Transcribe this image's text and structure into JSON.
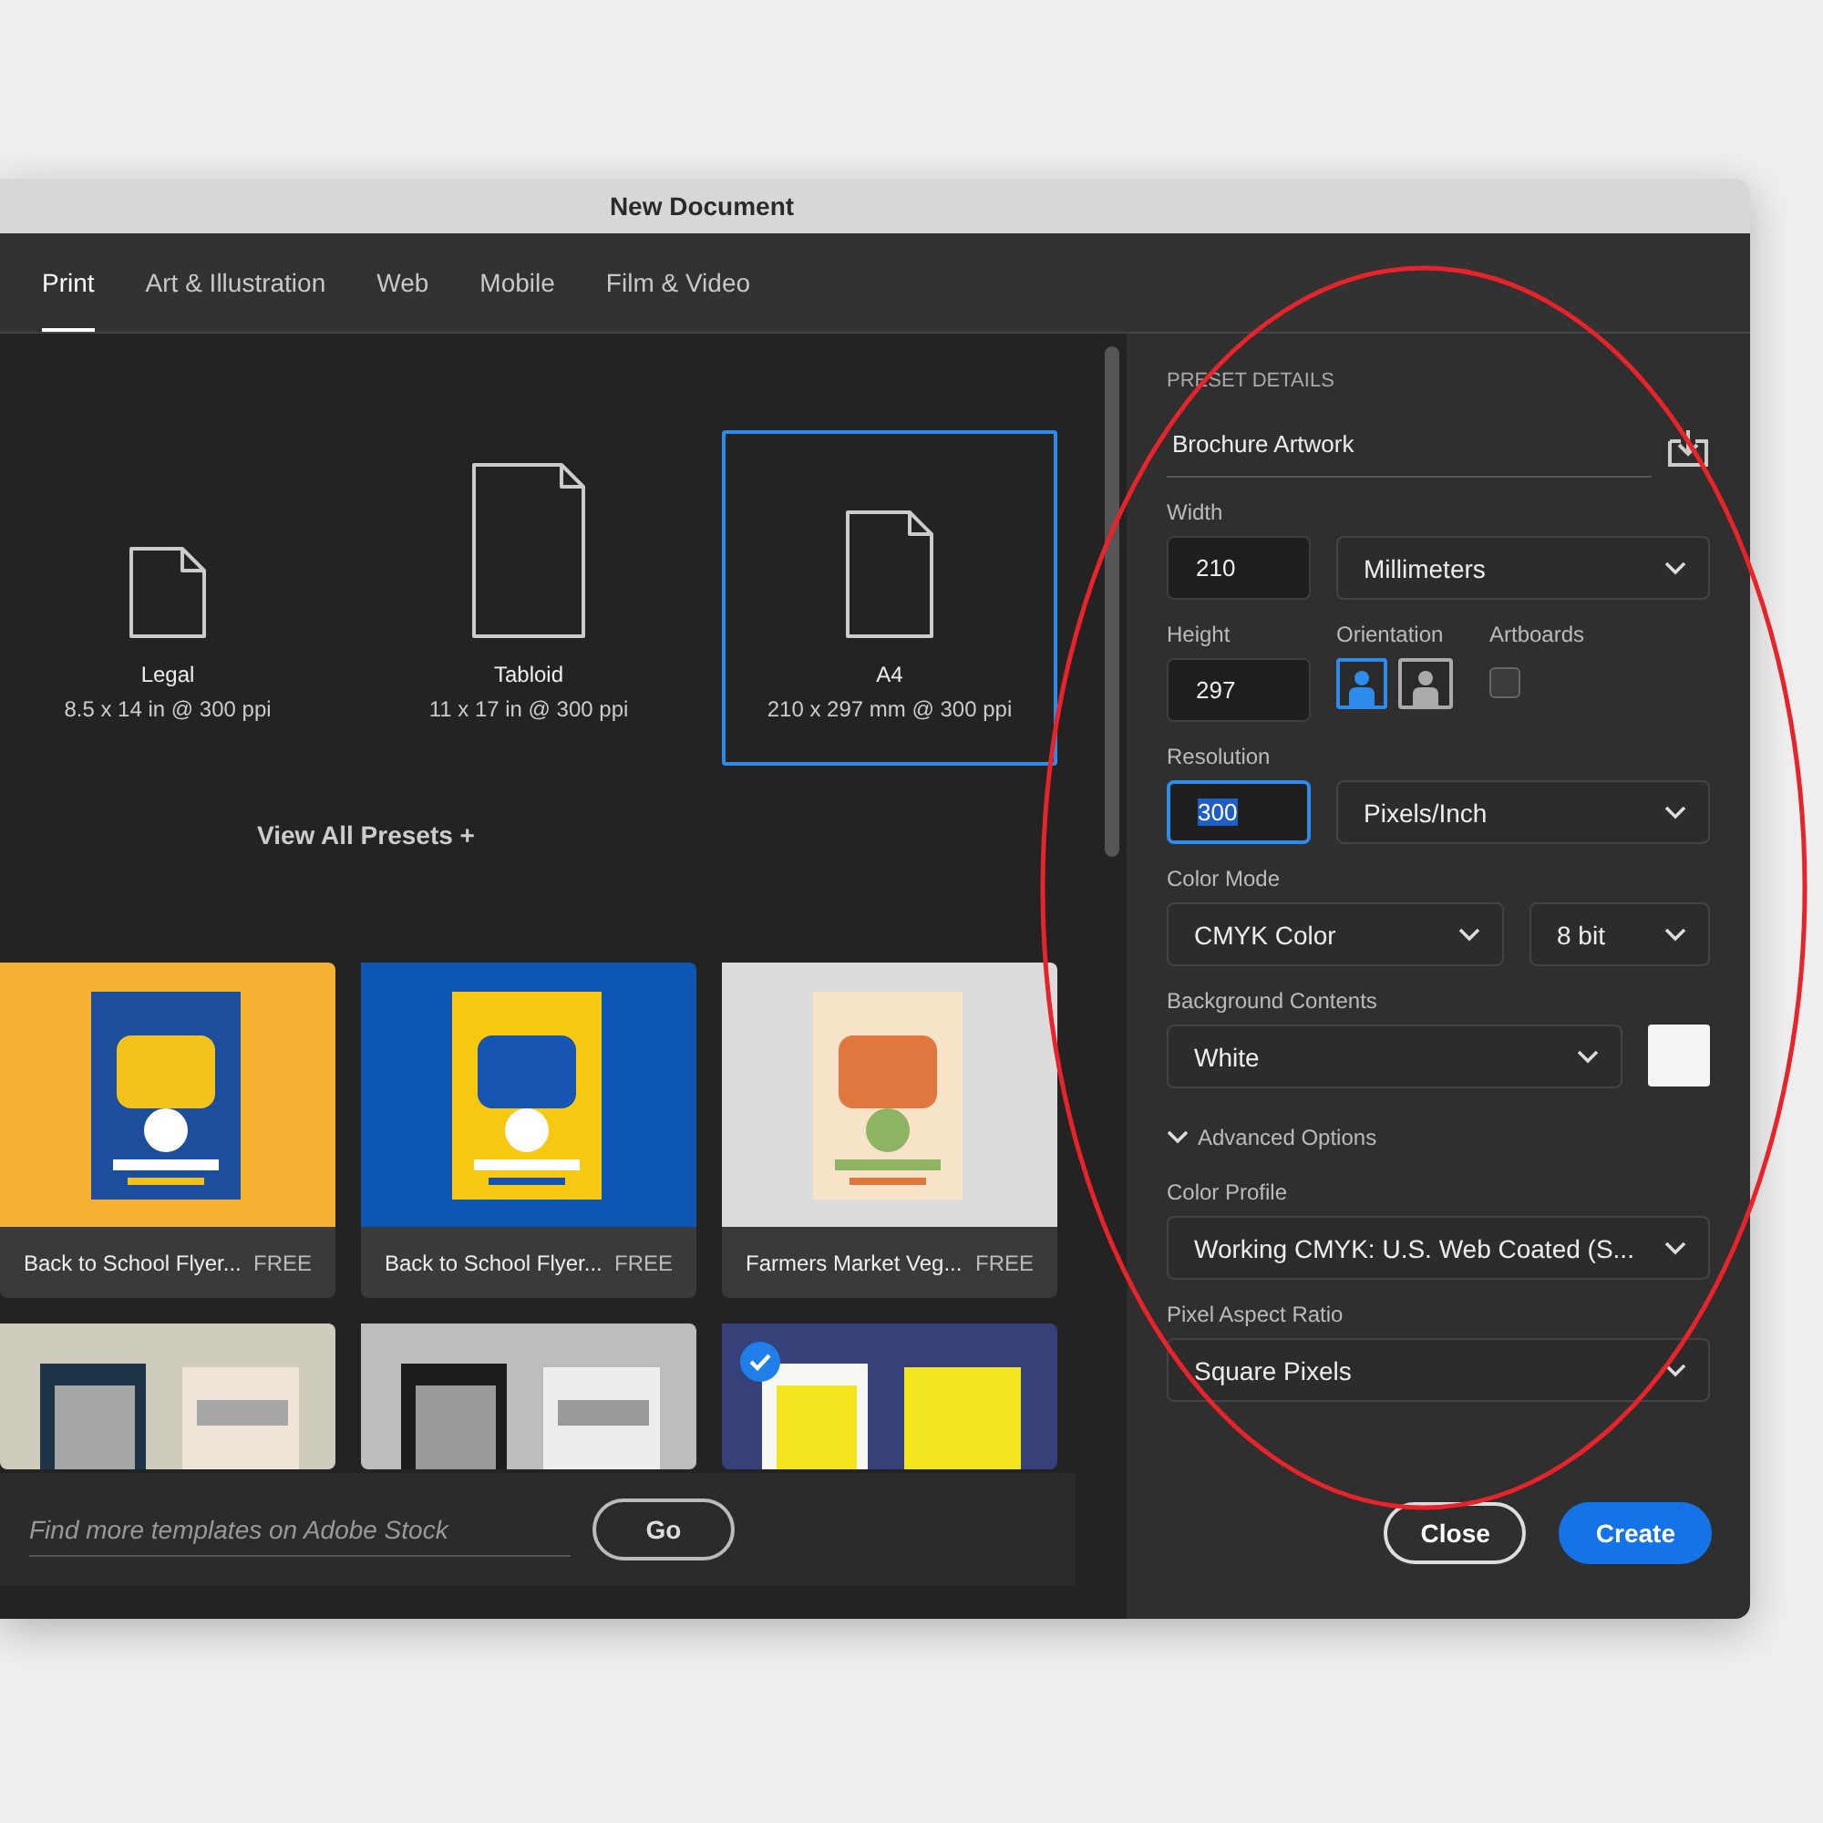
{
  "window": {
    "title": "New Document"
  },
  "tabs": [
    {
      "label": "Print",
      "selected": true
    },
    {
      "label": "Art & Illustration",
      "selected": false
    },
    {
      "label": "Web",
      "selected": false
    },
    {
      "label": "Mobile",
      "selected": false
    },
    {
      "label": "Film & Video",
      "selected": false
    }
  ],
  "presets": [
    {
      "name": "Legal",
      "size": "8.5 x 14 in @ 300 ppi",
      "kind": "small",
      "selected": false
    },
    {
      "name": "Tabloid",
      "size": "11 x 17 in @ 300 ppi",
      "kind": "tall",
      "selected": false
    },
    {
      "name": "A4",
      "size": "210 x 297 mm @ 300 ppi",
      "kind": "medium",
      "selected": true
    }
  ],
  "view_all": "View All Presets +",
  "templates": [
    {
      "title": "Back to School Flyer...",
      "price": "FREE",
      "selected": false
    },
    {
      "title": "Back to School Flyer...",
      "price": "FREE",
      "selected": false
    },
    {
      "title": "Farmers Market Veg...",
      "price": "FREE",
      "selected": false
    },
    {
      "selected": false
    },
    {
      "selected": false
    },
    {
      "selected": true
    }
  ],
  "search": {
    "placeholder": "Find more templates on Adobe Stock",
    "button": "Go"
  },
  "details": {
    "heading": "PRESET DETAILS",
    "name": "Brochure Artwork",
    "width": {
      "label": "Width",
      "value": "210",
      "unit": "Millimeters"
    },
    "height": {
      "label": "Height",
      "value": "297"
    },
    "orientation": {
      "label": "Orientation",
      "options": [
        {
          "kind": "portrait",
          "selected": true
        },
        {
          "kind": "landscape",
          "selected": false
        }
      ]
    },
    "artboards": {
      "label": "Artboards",
      "checked": false
    },
    "resolution": {
      "label": "Resolution",
      "value": "300",
      "unit": "Pixels/Inch",
      "focused": true
    },
    "color_mode": {
      "label": "Color Mode",
      "value": "CMYK Color",
      "depth": "8 bit"
    },
    "background": {
      "label": "Background Contents",
      "value": "White",
      "color": "#f4f4f4"
    },
    "advanced": {
      "label": "Advanced Options",
      "expanded": true
    },
    "color_profile": {
      "label": "Color Profile",
      "value": "Working CMYK: U.S. Web Coated (S..."
    },
    "pixel_aspect": {
      "label": "Pixel Aspect Ratio",
      "value": "Square Pixels"
    }
  },
  "buttons": [
    {
      "label": "Close",
      "kind": "secondary"
    },
    {
      "label": "Create",
      "kind": "primary"
    }
  ]
}
